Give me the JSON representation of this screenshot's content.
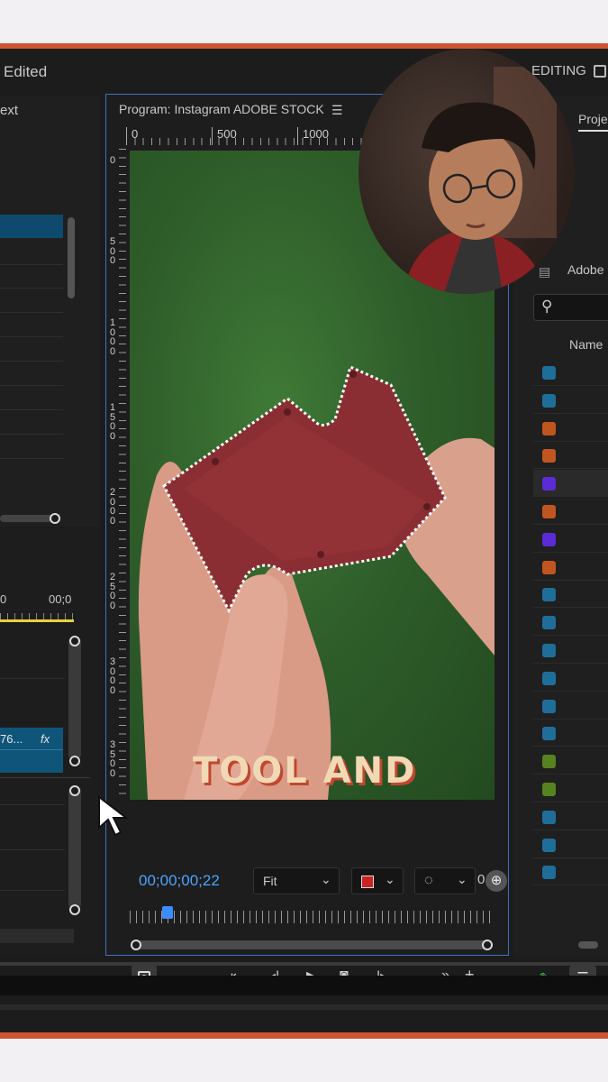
{
  "header": {
    "title": "Edited",
    "workspace_label": "EDITING"
  },
  "left_panel": {
    "title": "ext"
  },
  "timeline": {
    "time_start": "0",
    "time_end": "00;0",
    "clip_label": "76...",
    "fx_label": "fx"
  },
  "program_monitor": {
    "title": "Program: Instagram ADOBE STOCK",
    "menu_icon": "hamburger-icon",
    "ruler_top": [
      "0",
      "500",
      "1000"
    ],
    "ruler_left": [
      "0",
      "500",
      "1000",
      "1500",
      "2000",
      "2500",
      "3000",
      "3500"
    ],
    "timecode": "00;00;00;22",
    "fit_label": "Fit",
    "partial_label": "0",
    "caption": "TOOL AND",
    "playhead_fraction": 0.09
  },
  "project_panel": {
    "tab_label": "Proje",
    "folder_label": "Adobe S",
    "column_name": "Name",
    "item_colors": [
      "#1f6e9a",
      "#1f6e9a",
      "#c0561f",
      "#c0561f",
      "#5b2bd6",
      "#c0561f",
      "#5b2bd6",
      "#c0561f",
      "#1f6e9a",
      "#1f6e9a",
      "#1f6e9a",
      "#1f6e9a",
      "#1f6e9a",
      "#1f6e9a",
      "#56821f",
      "#56821f",
      "#1f6e9a",
      "#1f6e9a",
      "#1f6e9a"
    ]
  },
  "colors": {
    "accent_border": "#d2532f",
    "timecode": "#4da3ff",
    "playhead": "#3b8cff"
  }
}
